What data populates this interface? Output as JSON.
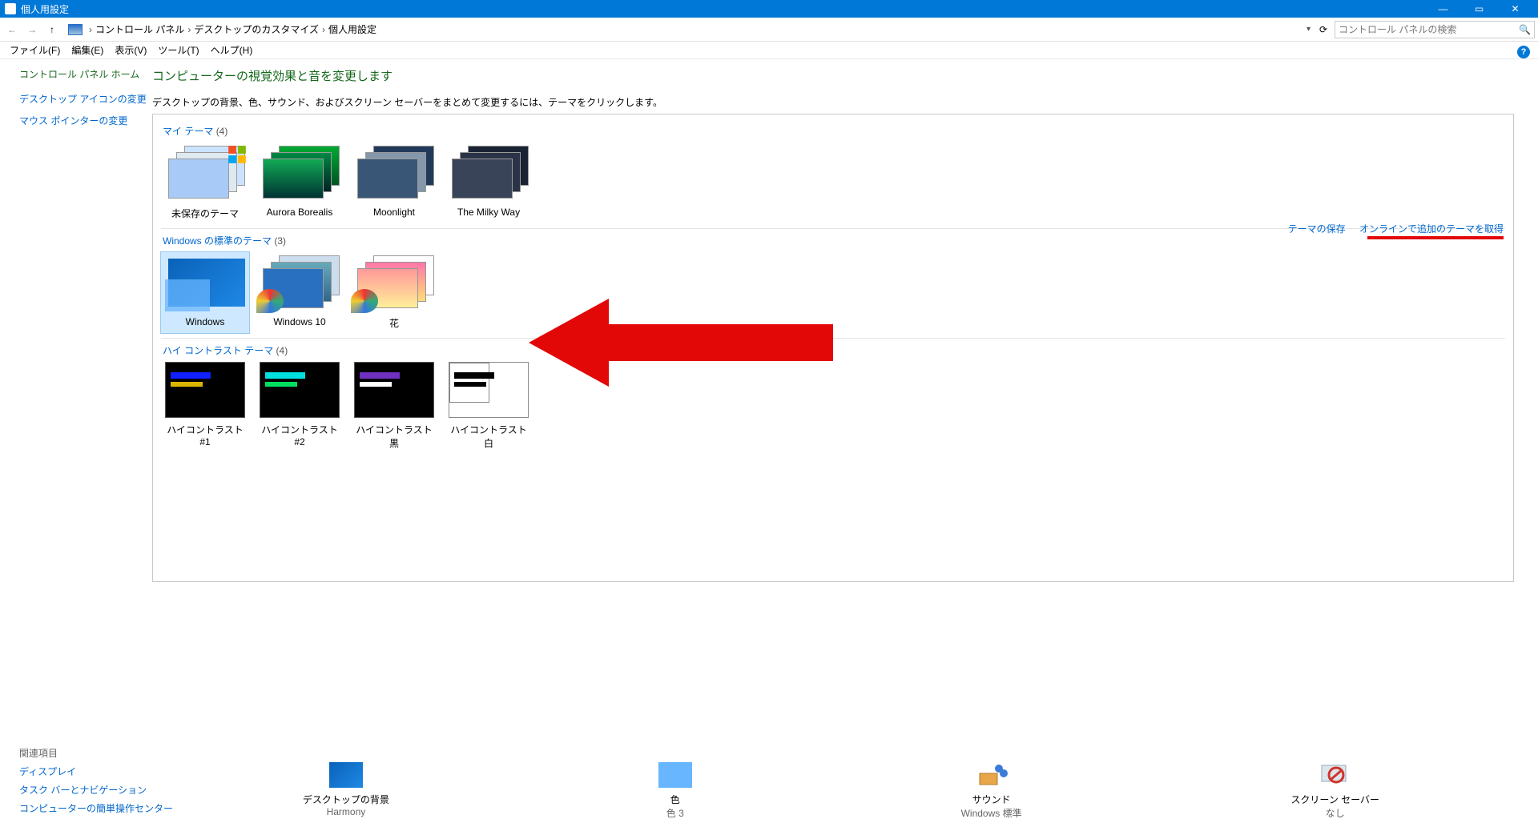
{
  "titlebar": {
    "title": "個人用設定"
  },
  "nav": {
    "breadcrumb": [
      "コントロール パネル",
      "デスクトップのカスタマイズ",
      "個人用設定"
    ],
    "search_placeholder": "コントロール パネルの検索"
  },
  "menubar": {
    "file": "ファイル(F)",
    "edit": "編集(E)",
    "view": "表示(V)",
    "tools": "ツール(T)",
    "help": "ヘルプ(H)"
  },
  "sidebar": {
    "home": "コントロール パネル ホーム",
    "links": [
      "デスクトップ アイコンの変更",
      "マウス ポインターの変更"
    ]
  },
  "related": {
    "header": "関連項目",
    "items": [
      "ディスプレイ",
      "タスク バーとナビゲーション",
      "コンピューターの簡単操作センター"
    ]
  },
  "main": {
    "heading": "コンピューターの視覚効果と音を変更します",
    "desc": "デスクトップの背景、色、サウンド、およびスクリーン セーバーをまとめて変更するには、テーマをクリックします。",
    "section_my": "マイ テーマ",
    "section_my_count": "(4)",
    "section_std": "Windows の標準のテーマ",
    "section_std_count": "(3)",
    "section_hc": "ハイ コントラスト テーマ",
    "section_hc_count": "(4)",
    "link_save": "テーマの保存",
    "link_online": "オンラインで追加のテーマを取得",
    "my_themes": [
      "未保存のテーマ",
      "Aurora Borealis",
      "Moonlight",
      "The Milky Way"
    ],
    "std_themes": [
      "Windows",
      "Windows 10",
      "花"
    ],
    "hc_themes": [
      "ハイコントラスト #1",
      "ハイコントラスト #2",
      "ハイコントラスト 黒",
      "ハイコントラスト 白"
    ]
  },
  "bottom": {
    "items": [
      {
        "title": "デスクトップの背景",
        "sub": "Harmony"
      },
      {
        "title": "色",
        "sub": "色 3"
      },
      {
        "title": "サウンド",
        "sub": "Windows 標準"
      },
      {
        "title": "スクリーン セーバー",
        "sub": "なし"
      }
    ]
  }
}
